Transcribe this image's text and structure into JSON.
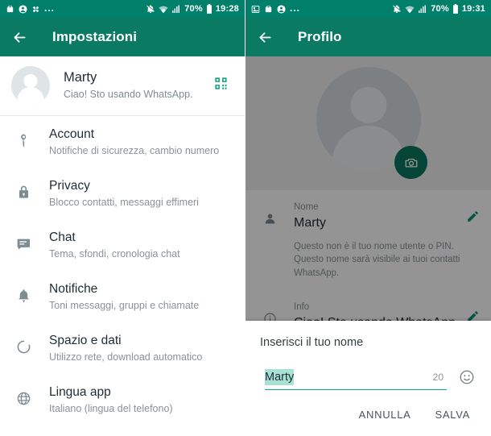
{
  "left_phone": {
    "status_bar": {
      "left_icons": [
        "bag-icon",
        "account-circle-icon",
        "pinwheel-icon"
      ],
      "overflow": "...",
      "right_icons": [
        "bell-muted-icon",
        "wifi-icon",
        "signal-icon",
        "battery-icon"
      ],
      "battery_text": "70%",
      "clock": "19:28"
    },
    "appbar": {
      "back_icon": "arrow-back-icon",
      "title": "Impostazioni"
    },
    "profile": {
      "name": "Marty",
      "status": "Ciao! Sto usando WhatsApp.",
      "qr_icon": "qr-code-icon",
      "avatar_icon": "person-avatar-icon"
    },
    "items": [
      {
        "icon": "key-icon",
        "title": "Account",
        "subtitle": "Notifiche di sicurezza, cambio numero"
      },
      {
        "icon": "lock-icon",
        "title": "Privacy",
        "subtitle": "Blocco contatti, messaggi effimeri"
      },
      {
        "icon": "chat-icon",
        "title": "Chat",
        "subtitle": "Tema, sfondi, cronologia chat"
      },
      {
        "icon": "bell-icon",
        "title": "Notifiche",
        "subtitle": "Toni messaggi, gruppi e chiamate"
      },
      {
        "icon": "data-usage-icon",
        "title": "Spazio e dati",
        "subtitle": "Utilizzo rete, download automatico"
      },
      {
        "icon": "globe-icon",
        "title": "Lingua app",
        "subtitle": "Italiano (lingua del telefono)"
      }
    ]
  },
  "right_phone": {
    "status_bar": {
      "left_icons": [
        "image-icon",
        "bag-icon",
        "account-circle-icon"
      ],
      "overflow": "...",
      "right_icons": [
        "bell-muted-icon",
        "wifi-icon",
        "signal-icon",
        "battery-icon"
      ],
      "battery_text": "70%",
      "clock": "19:31"
    },
    "appbar": {
      "back_icon": "arrow-back-icon",
      "title": "Profilo"
    },
    "photo": {
      "avatar_icon": "person-avatar-icon",
      "camera_icon": "camera-icon"
    },
    "fields": [
      {
        "icon": "person-icon",
        "label": "Nome",
        "value": "Marty",
        "edit_icon": "pencil-icon",
        "help": "Questo non è il tuo nome utente o PIN. Questo nome sarà visibile ai tuoi contatti WhatsApp."
      },
      {
        "icon": "info-icon",
        "label": "Info",
        "value": "Ciao! Sto usando WhatsApp.",
        "edit_icon": "pencil-icon",
        "help": ""
      }
    ],
    "dialog": {
      "title": "Inserisci il tuo nome",
      "input_value": "Marty",
      "input_placeholder": "Inserisci il tuo nome",
      "counter": "20",
      "emoji_icon": "emoji-smiley-icon",
      "cancel_label": "ANNULLA",
      "save_label": "SALVA"
    }
  },
  "colors": {
    "status_bar": "#00806b",
    "app_bar": "#0a7a63",
    "accent": "#0fa58a",
    "fab": "#07785f",
    "selection": "#a9e2d5",
    "text_primary": "#1f2c34",
    "text_secondary": "#8a9398"
  }
}
